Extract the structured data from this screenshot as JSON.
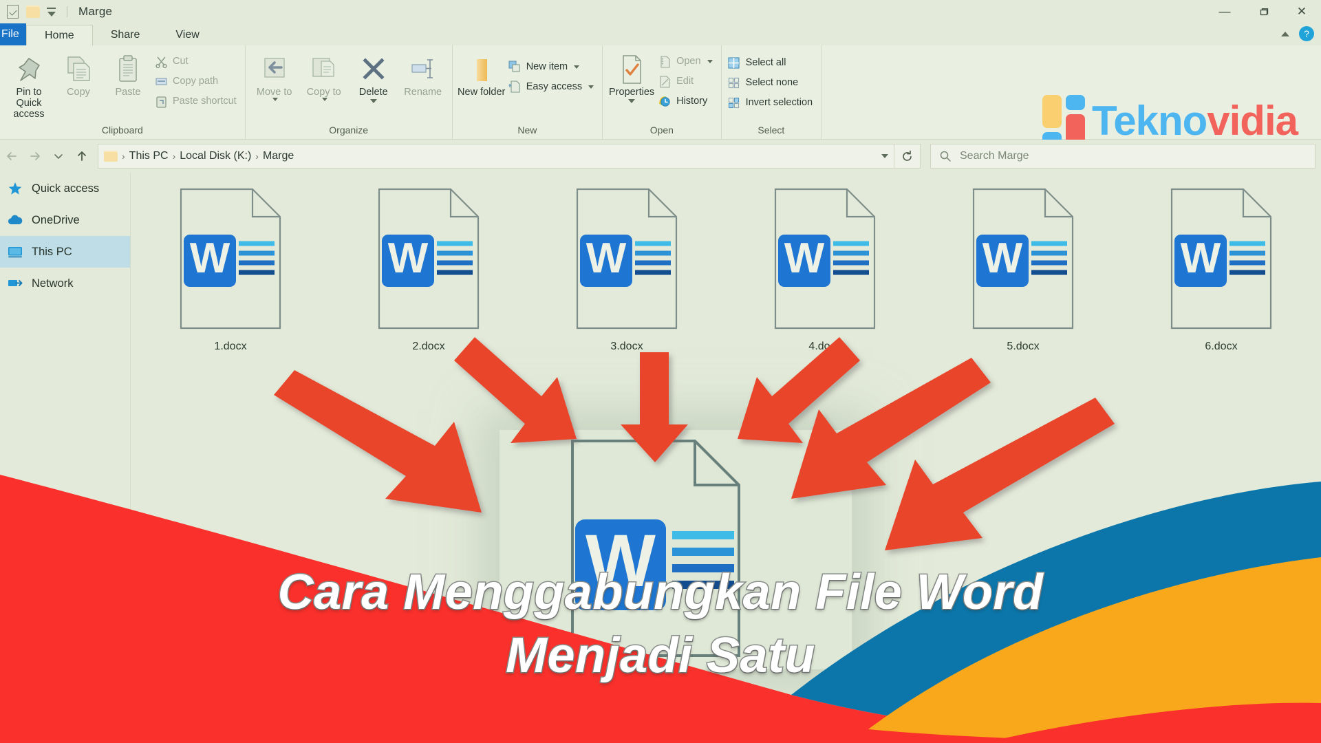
{
  "window": {
    "title": "Marge",
    "quick_access": [
      "properties-checkbox-icon",
      "folder-icon",
      "customize-caret-icon"
    ],
    "controls": {
      "minimize": "—",
      "maximize": "▭",
      "close": "✕"
    }
  },
  "ribbon": {
    "tabs": [
      {
        "label": "File",
        "active": false,
        "accent": "#1872c6"
      },
      {
        "label": "Home",
        "active": true
      },
      {
        "label": "Share",
        "active": false
      },
      {
        "label": "View",
        "active": false
      }
    ],
    "collapse_label": "^",
    "help_label": "?",
    "groups": [
      {
        "name": "Clipboard",
        "big_buttons": [
          {
            "label": "Pin to Quick access",
            "icon": "pin-icon",
            "dim": false
          },
          {
            "label": "Copy",
            "icon": "copy-icon",
            "dim": true
          },
          {
            "label": "Paste",
            "icon": "paste-icon",
            "dim": true
          }
        ],
        "small_buttons": [
          {
            "label": "Cut",
            "icon": "scissors-icon",
            "dim": true
          },
          {
            "label": "Copy path",
            "icon": "copy-path-icon",
            "dim": true
          },
          {
            "label": "Paste shortcut",
            "icon": "paste-shortcut-icon",
            "dim": true
          }
        ]
      },
      {
        "name": "Organize",
        "big_buttons": [
          {
            "label": "Move to",
            "icon": "move-to-icon",
            "dim": true,
            "caret": true
          },
          {
            "label": "Copy to",
            "icon": "copy-to-icon",
            "dim": true,
            "caret": true
          },
          {
            "label": "Delete",
            "icon": "delete-x-icon",
            "dim": false,
            "caret": true
          },
          {
            "label": "Rename",
            "icon": "rename-icon",
            "dim": true
          }
        ],
        "small_buttons": []
      },
      {
        "name": "New",
        "big_buttons": [
          {
            "label": "New folder",
            "icon": "new-folder-icon",
            "dim": false
          }
        ],
        "small_buttons": [
          {
            "label": "New item",
            "icon": "new-item-icon",
            "dim": false,
            "caret": true
          },
          {
            "label": "Easy access",
            "icon": "easy-access-icon",
            "dim": false,
            "caret": true
          }
        ]
      },
      {
        "name": "Open",
        "big_buttons": [
          {
            "label": "Properties",
            "icon": "properties-icon",
            "dim": false,
            "caret": true
          }
        ],
        "small_buttons": [
          {
            "label": "Open",
            "icon": "open-icon",
            "dim": true,
            "caret": true
          },
          {
            "label": "Edit",
            "icon": "edit-icon",
            "dim": true
          },
          {
            "label": "History",
            "icon": "history-icon",
            "dim": false
          }
        ]
      },
      {
        "name": "Select",
        "big_buttons": [],
        "small_buttons": [
          {
            "label": "Select all",
            "icon": "select-all-icon",
            "dim": false
          },
          {
            "label": "Select none",
            "icon": "select-none-icon",
            "dim": false
          },
          {
            "label": "Invert selection",
            "icon": "invert-selection-icon",
            "dim": false
          }
        ]
      }
    ]
  },
  "brand": {
    "name_part1": "Tekno",
    "name_part2": "vidia",
    "color_blue": "#4db5f0",
    "color_red": "#f2635c",
    "color_yellow": "#f9cf70"
  },
  "address": {
    "back_icon": "back-arrow-icon",
    "forward_icon": "forward-arrow-icon",
    "recent_icon": "recent-locations-caret-icon",
    "up_icon": "up-arrow-icon",
    "breadcrumb": [
      "This PC",
      "Local Disk (K:)",
      "Marge"
    ],
    "separator": "›",
    "refresh_icon": "refresh-icon",
    "dropdown_icon": "chevron-down-icon"
  },
  "search": {
    "placeholder": "Search Marge",
    "icon": "search-icon"
  },
  "sidebar": {
    "items": [
      {
        "label": "Quick access",
        "icon": "star-icon",
        "selected": false
      },
      {
        "label": "OneDrive",
        "icon": "cloud-icon",
        "selected": false
      },
      {
        "label": "This PC",
        "icon": "monitor-icon",
        "selected": true
      },
      {
        "label": "Network",
        "icon": "network-icon",
        "selected": false
      }
    ]
  },
  "files": [
    {
      "name": "1.docx",
      "type": "word-document"
    },
    {
      "name": "2.docx",
      "type": "word-document"
    },
    {
      "name": "3.docx",
      "type": "word-document"
    },
    {
      "name": "4.docx",
      "type": "word-document"
    },
    {
      "name": "5.docx",
      "type": "word-document"
    },
    {
      "name": "6.docx",
      "type": "word-document"
    }
  ],
  "merged_document": {
    "type": "word-document",
    "label": ""
  },
  "arrow_color": "#e8452c",
  "overlay": {
    "title_line1": "Cara Menggabungkan File Word",
    "title_line2": "Menjadi Satu",
    "wave_colors": {
      "red": "#f9302b",
      "blue": "#0c76aa",
      "orange": "#f9a81c",
      "red_bottom": "#f9302b"
    }
  }
}
